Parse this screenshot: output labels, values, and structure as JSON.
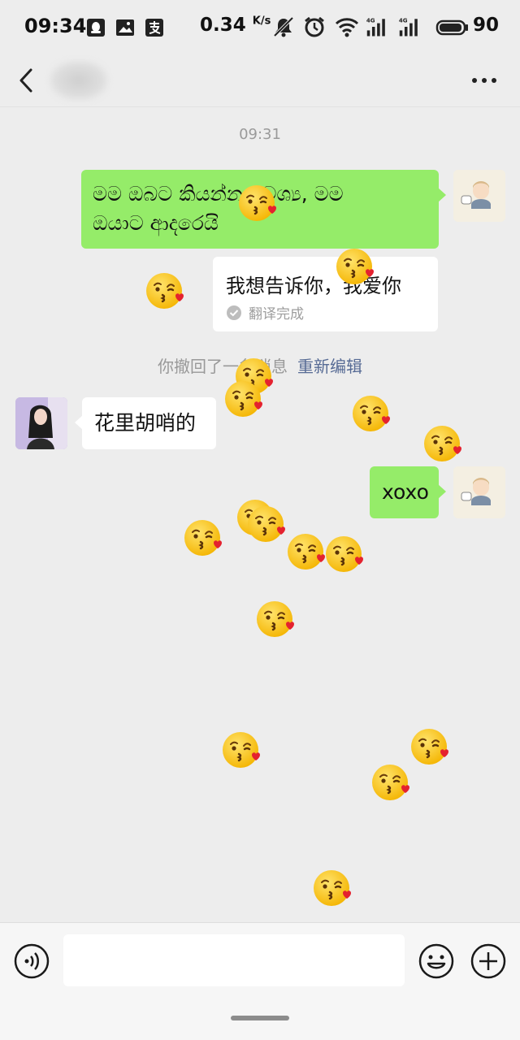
{
  "status_bar": {
    "time": "09:34",
    "net_speed": "0.34",
    "net_speed_unit": "K/s",
    "network_type": "4G",
    "battery": "90",
    "icons": [
      "qq-icon",
      "image-notification-icon",
      "alipay-icon",
      "mute-icon",
      "alarm-icon",
      "wifi-icon",
      "signal-icon",
      "battery-icon"
    ]
  },
  "nav": {
    "contact_name": "",
    "back_icon": "chevron-left-icon",
    "more_icon": "more-icon"
  },
  "chat": {
    "time_label": "09:31",
    "message1": {
      "sender": "me",
      "line1": "මම ඔබට කියන්න අවශ්‍ය, මම",
      "line2": "ඔයාට ආදරෙයි"
    },
    "translation": {
      "text": "我想告诉你，我爱你",
      "status": "翻译完成"
    },
    "recall": {
      "text": "你撤回了一条消息",
      "action": "重新编辑"
    },
    "message2": {
      "sender": "other",
      "text": "花里胡哨的"
    },
    "message3": {
      "sender": "me",
      "text": "xoxo"
    },
    "effect_emoji": "😘"
  },
  "input_bar": {
    "placeholder": "",
    "voice_icon": "voice-icon",
    "emoji_icon": "emoji-icon",
    "plus_icon": "plus-icon"
  },
  "colors": {
    "background": "#ededed",
    "bubble_me": "#95ec69",
    "bubble_other": "#ffffff",
    "link": "#576b95"
  }
}
